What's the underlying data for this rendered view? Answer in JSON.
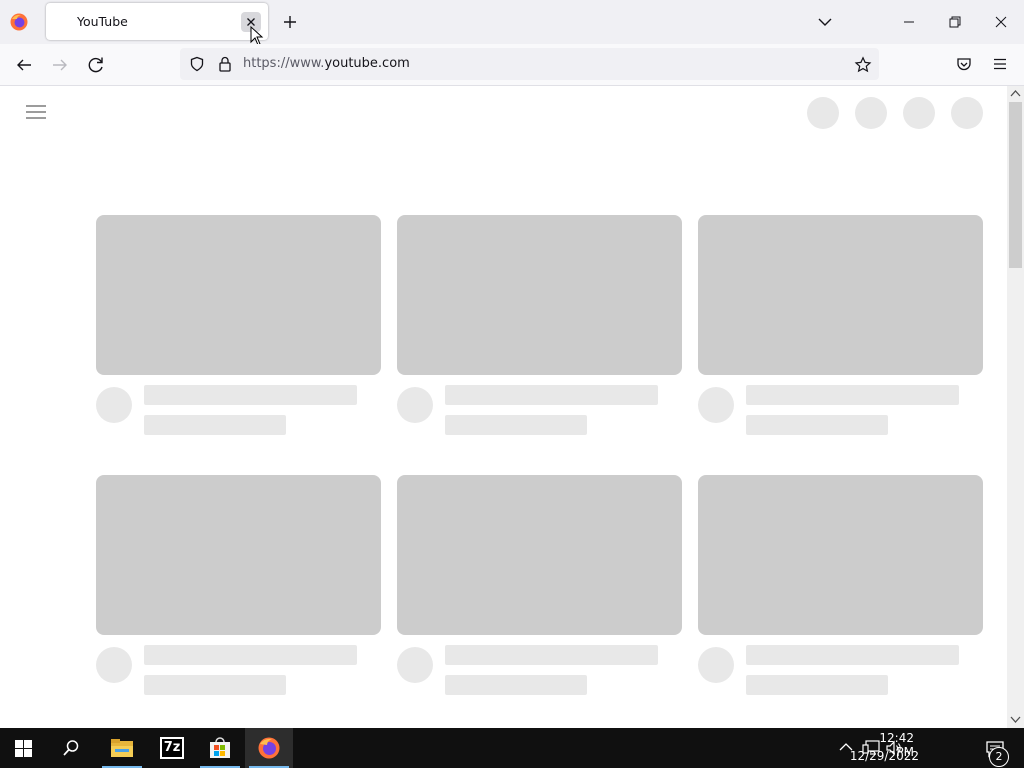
{
  "browser": {
    "tab": {
      "title": "YouTube"
    },
    "url": {
      "prefix": "https://www.",
      "domain": "youtube.com"
    }
  },
  "taskbar": {
    "apps": [
      {
        "name": "file-explorer",
        "label": ""
      },
      {
        "name": "7zip",
        "label": "7z"
      },
      {
        "name": "microsoft-store",
        "label": ""
      },
      {
        "name": "firefox",
        "label": ""
      }
    ],
    "time": "12:42 PM",
    "date": "12/29/2022",
    "notification_count": "2"
  },
  "colors": {
    "skeleton_thumb": "#cccccc",
    "skeleton_text": "#e8e8e8",
    "taskbar_bg": "#101010",
    "taskbar_accent": "#76b9ed"
  }
}
